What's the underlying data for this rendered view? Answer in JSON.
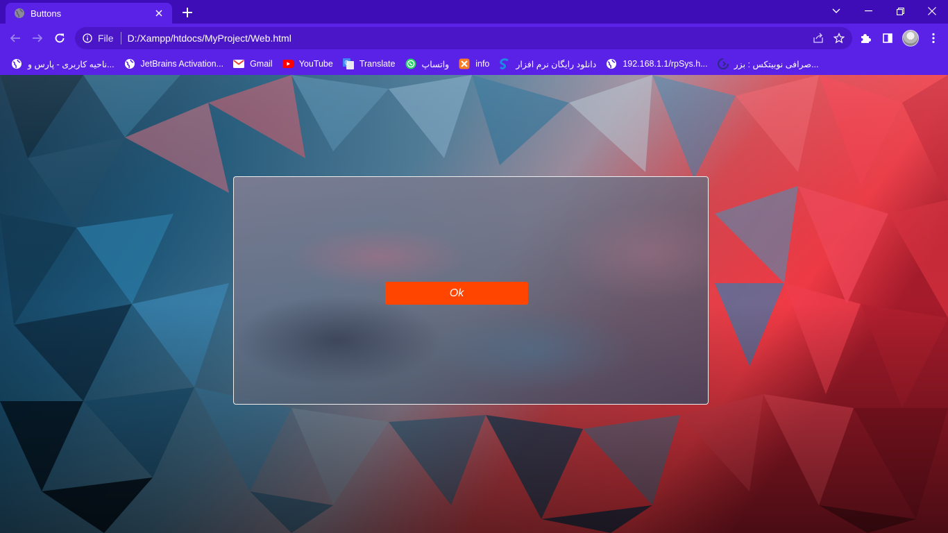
{
  "tab": {
    "title": "Buttons"
  },
  "omnibox": {
    "scheme_label": "File",
    "url": "D:/Xampp/htdocs/MyProject/Web.html"
  },
  "bookmarks": [
    {
      "label": "ناحیه کاربری - پارس و...",
      "icon": "globe-icon"
    },
    {
      "label": "JetBrains Activation...",
      "icon": "globe-icon"
    },
    {
      "label": "Gmail",
      "icon": "gmail-icon"
    },
    {
      "label": "YouTube",
      "icon": "youtube-icon"
    },
    {
      "label": "Translate",
      "icon": "translate-icon"
    },
    {
      "label": "واتساپ",
      "icon": "whatsapp-icon"
    },
    {
      "label": "info",
      "icon": "xampp-icon"
    },
    {
      "label": "دانلود رایگان نرم افزار",
      "icon": "soft-icon"
    },
    {
      "label": "192.168.1.1/rpSys.h...",
      "icon": "globe-icon"
    },
    {
      "label": "صرافی نوبیتکس : بزر...",
      "icon": "nobitex-icon"
    }
  ],
  "card": {
    "button_label": "Ok"
  },
  "colors": {
    "titlebar": "#3f0db8",
    "toolbar": "#5a21e6",
    "ok_button": "#ff4500"
  }
}
